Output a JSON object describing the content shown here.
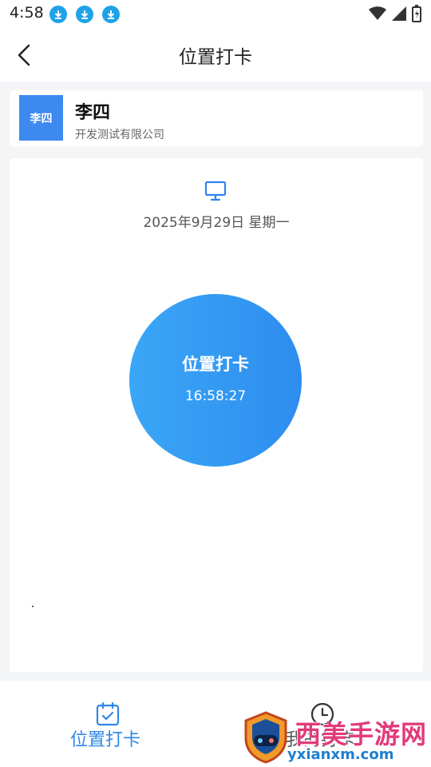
{
  "status_bar": {
    "time": "4:58",
    "download_icons": [
      "download-icon",
      "download-icon",
      "download-icon"
    ],
    "system_icons": [
      "wifi-icon",
      "signal-icon",
      "battery-icon"
    ]
  },
  "header": {
    "title": "位置打卡",
    "back_icon": "chevron-left-icon"
  },
  "user": {
    "avatar_text": "李四",
    "name": "李四",
    "company": "开发测试有限公司"
  },
  "checkin": {
    "date": "2025年9月29日 星期一",
    "button_label": "位置打卡",
    "time": "16:58:27",
    "icon": "monitor-icon"
  },
  "tabs": [
    {
      "label": "位置打卡",
      "icon": "calendar-check-icon",
      "active": true
    },
    {
      "label": "我的打卡",
      "icon": "clock-icon",
      "active": false
    }
  ],
  "watermark": {
    "text": "西美手游网",
    "url": "yxianxm.com"
  },
  "colors": {
    "accent": "#2f86e8",
    "avatar_bg": "#3d89f0",
    "circle_start": "#3aa6f6",
    "circle_end": "#2e8def"
  }
}
